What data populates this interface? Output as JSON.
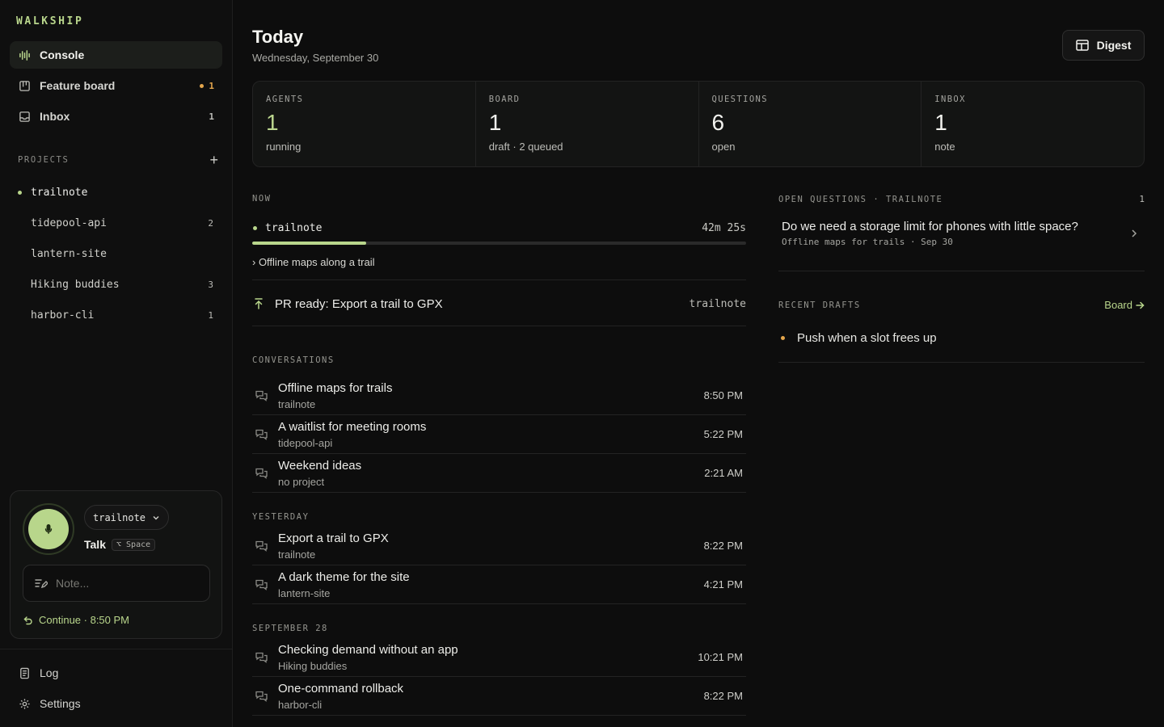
{
  "brand": "WALKSHIP",
  "nav": [
    {
      "label": "Console",
      "count": ""
    },
    {
      "label": "Feature board",
      "count": "1"
    },
    {
      "label": "Inbox",
      "count": "1"
    }
  ],
  "projects_label": "PROJECTS",
  "projects": [
    {
      "name": "trailnote",
      "count": ""
    },
    {
      "name": "tidepool-api",
      "count": "2"
    },
    {
      "name": "lantern-site",
      "count": ""
    },
    {
      "name": "Hiking buddies",
      "count": "3"
    },
    {
      "name": "harbor-cli",
      "count": "1"
    }
  ],
  "talk": {
    "project": "trailnote",
    "label": "Talk",
    "shortcut": "⌥ Space",
    "note_placeholder": "Note...",
    "continue": "Continue · 8:50 PM"
  },
  "bottom_nav": [
    {
      "label": "Log"
    },
    {
      "label": "Settings"
    }
  ],
  "header": {
    "title": "Today",
    "date": "Wednesday, September 30",
    "digest": "Digest"
  },
  "stats": [
    {
      "label": "AGENTS",
      "value": "1",
      "sub": "running"
    },
    {
      "label": "BOARD",
      "value": "1",
      "sub": "draft · 2 queued"
    },
    {
      "label": "QUESTIONS",
      "value": "6",
      "sub": "open"
    },
    {
      "label": "INBOX",
      "value": "1",
      "sub": "note"
    }
  ],
  "now": {
    "label": "NOW",
    "project": "trailnote",
    "elapsed": "42m 25s",
    "progress": 0.23,
    "task": "› Offline maps along a trail",
    "pr_title": "PR ready: Export a trail to GPX",
    "pr_project": "trailnote"
  },
  "conversations_label": "CONVERSATIONS",
  "today_conversations": [
    {
      "title": "Offline maps for trails",
      "project": "trailnote",
      "time": "8:50 PM"
    },
    {
      "title": "A waitlist for meeting rooms",
      "project": "tidepool-api",
      "time": "5:22 PM"
    },
    {
      "title": "Weekend ideas",
      "project": "no project",
      "time": "2:21 AM"
    }
  ],
  "yesterday_label": "YESTERDAY",
  "yesterday_conversations": [
    {
      "title": "Export a trail to GPX",
      "project": "trailnote",
      "time": "8:22 PM"
    },
    {
      "title": "A dark theme for the site",
      "project": "lantern-site",
      "time": "4:21 PM"
    }
  ],
  "sep28_label": "SEPTEMBER 28",
  "sep28_conversations": [
    {
      "title": "Checking demand without an app",
      "project": "Hiking buddies",
      "time": "10:21 PM"
    },
    {
      "title": "One-command rollback",
      "project": "harbor-cli",
      "time": "8:22 PM"
    }
  ],
  "questions": {
    "label": "OPEN QUESTIONS · TRAILNOTE",
    "count": "1",
    "items": [
      {
        "title": "Do we need a storage limit for phones with little space?",
        "sub": "Offline maps for trails · Sep 30"
      }
    ]
  },
  "drafts": {
    "label": "RECENT DRAFTS",
    "link": "Board",
    "items": [
      {
        "title": "Push when a slot frees up"
      }
    ]
  },
  "colors": {
    "accent": "#b9d68c",
    "warning": "#e4a64c",
    "background": "#0d0d0d"
  }
}
